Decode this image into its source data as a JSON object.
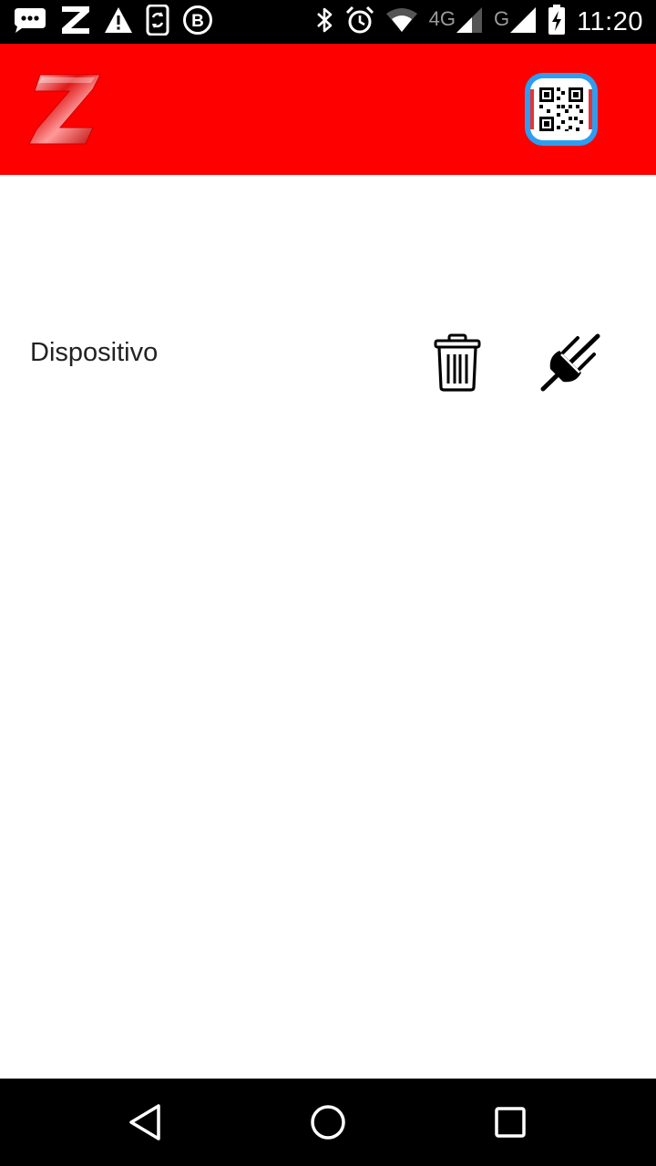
{
  "status_bar": {
    "time": "11:20",
    "network_primary": "4G",
    "network_secondary": "G",
    "icons": [
      "chat-icon",
      "z-app-icon",
      "warning-icon",
      "sync-phone-icon",
      "b-app-icon",
      "bluetooth-icon",
      "alarm-icon",
      "wifi-icon",
      "signal-icon",
      "signal-icon",
      "battery-charging-icon"
    ]
  },
  "app_bar": {
    "color": "#ff0000",
    "logo_icon": "z-logo",
    "action_icon": "qr-code-icon"
  },
  "devices": [
    {
      "name": "Dispositivo",
      "actions": [
        "trash-icon",
        "unplug-icon"
      ]
    }
  ],
  "nav_bar": {
    "buttons": [
      "back-icon",
      "home-icon",
      "recents-icon"
    ]
  }
}
